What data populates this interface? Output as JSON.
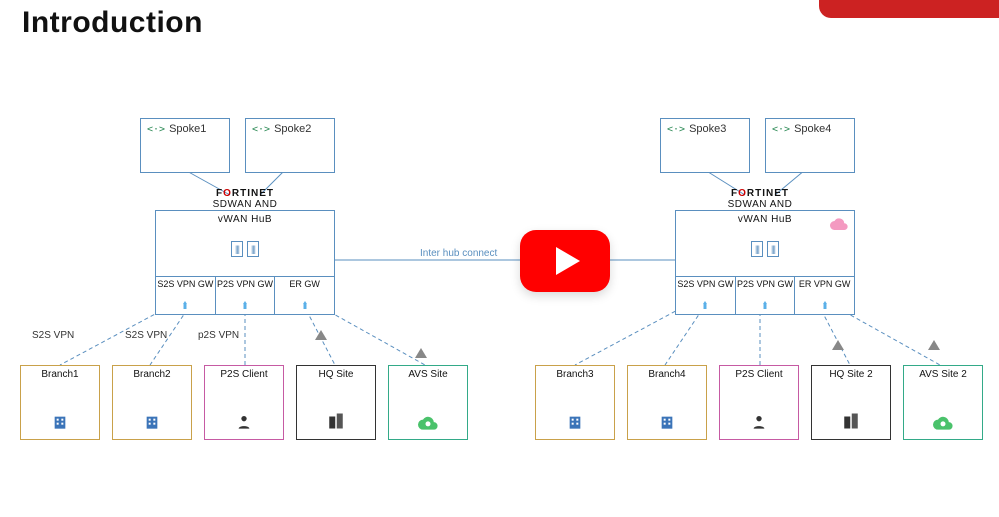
{
  "title": "Introduction",
  "inter_hub_label": "Inter hub connect",
  "hubs": [
    {
      "brand": "FORTINET",
      "sub": "SDWAN AND NGFW",
      "name": "vWAN HuB",
      "gateways": [
        "S2S VPN GW",
        "P2S VPN GW",
        "ER GW"
      ],
      "spokes": [
        "Spoke1",
        "Spoke2"
      ]
    },
    {
      "brand": "FORTINET",
      "sub": "SDWAN AND NGFW",
      "name": "vWAN HuB",
      "gateways": [
        "S2S VPN GW",
        "P2S VPN GW",
        "ER VPN GW"
      ],
      "spokes": [
        "Spoke3",
        "Spoke4"
      ]
    }
  ],
  "left_vpn_labels": {
    "s2s_a": "S2S VPN",
    "s2s_b": "S2S VPN",
    "p2s": "p2S VPN"
  },
  "sites_left": [
    "Branch1",
    "Branch2",
    "P2S Client",
    "HQ Site",
    "AVS Site"
  ],
  "sites_right": [
    "Branch3",
    "Branch4",
    "P2S Client",
    "HQ Site 2",
    "AVS Site 2"
  ]
}
